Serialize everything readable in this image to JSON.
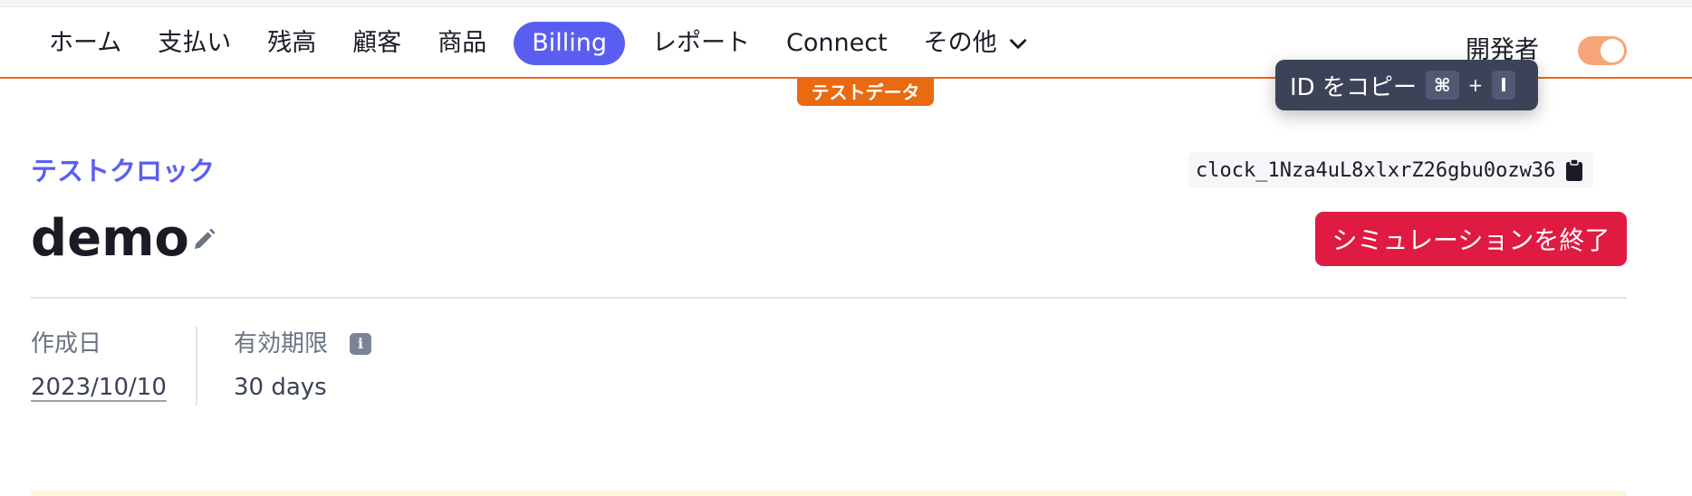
{
  "nav": {
    "items": [
      "ホーム",
      "支払い",
      "残高",
      "顧客",
      "商品",
      "Billing",
      "レポート",
      "Connect"
    ],
    "active_item": "Billing",
    "more_label": "その他",
    "more_icon": "chevron-down-icon"
  },
  "header": {
    "developer_label": "開発者",
    "developer_toggle_on": true,
    "test_data_badge": "テストデータ"
  },
  "tooltip": {
    "label": "ID をコピー",
    "shortcut_key1": "⌘",
    "shortcut_plus": "+",
    "shortcut_key2": "I"
  },
  "page": {
    "breadcrumb": "テストクロック",
    "object_id": "clock_1Nza4uL8xlxrZ26gbu0ozw36",
    "title": "demo",
    "end_simulation_label": "シミュレーションを終了"
  },
  "meta": {
    "created_label": "作成日",
    "created_value": "2023/10/10",
    "expiry_label": "有効期限",
    "expiry_value": "30 days",
    "expiry_info_icon": "info-icon"
  },
  "colors": {
    "accent": "#5a5ef0",
    "test_mode": "#ea6a12",
    "danger": "#df1b41"
  }
}
